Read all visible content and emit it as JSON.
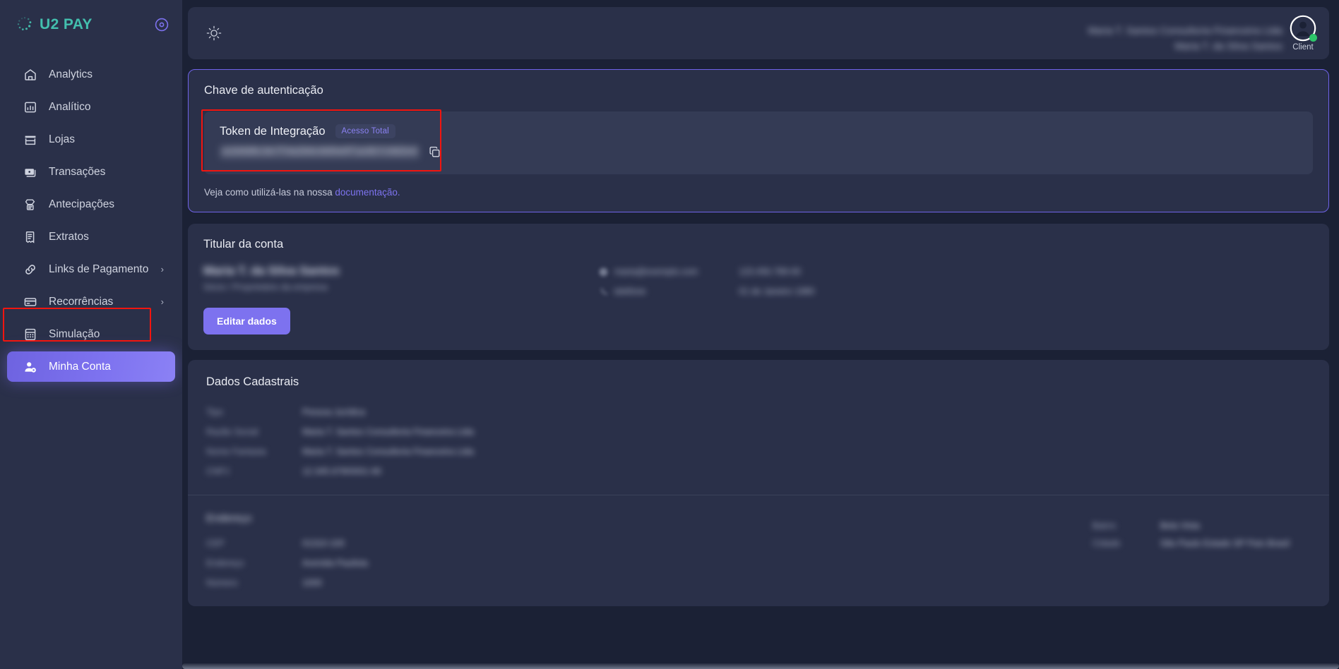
{
  "brand": {
    "name": "U2 PAY",
    "logo_color": "#43bfae",
    "spinner_icon": "dotted-circle-icon",
    "collapse_icon": "circle-dot-icon"
  },
  "accent": {
    "purple": "#7d72ef",
    "teal": "#43bfae",
    "green": "#2ec66a",
    "annotation_red": "#f2150f"
  },
  "sidebar": {
    "items": [
      {
        "label": "Analytics",
        "icon": "home-icon",
        "active": false,
        "has_chevron": false
      },
      {
        "label": "Analítico",
        "icon": "bar-chart-icon",
        "active": false,
        "has_chevron": false
      },
      {
        "label": "Lojas",
        "icon": "store-icon",
        "active": false,
        "has_chevron": false
      },
      {
        "label": "Transações",
        "icon": "money-icon",
        "active": false,
        "has_chevron": false
      },
      {
        "label": "Antecipações",
        "icon": "cash-hand-icon",
        "active": false,
        "has_chevron": false
      },
      {
        "label": "Extratos",
        "icon": "receipt-icon",
        "active": false,
        "has_chevron": false
      },
      {
        "label": "Links de Pagamento",
        "icon": "link-icon",
        "active": false,
        "has_chevron": true,
        "chevron": "›"
      },
      {
        "label": "Recorrências",
        "icon": "credit-card-icon",
        "active": false,
        "has_chevron": true,
        "chevron": "›"
      },
      {
        "label": "Simulação",
        "icon": "calculator-icon",
        "active": false,
        "has_chevron": false
      },
      {
        "label": "Minha Conta",
        "icon": "user-gear-icon",
        "active": true,
        "has_chevron": false
      }
    ]
  },
  "topbar": {
    "theme_toggle_icon": "sun-icon",
    "user_name_blurred": "Maria T. Santos Consultoria Financeira Ltda",
    "user_email_blurred": "Maria T. da Silva Santos",
    "role_label": "Client",
    "avatar_icon": "user-avatar-icon",
    "status_dot_color": "#2ec66a"
  },
  "auth_card": {
    "title": "Chave de autenticação",
    "token_label": "Token de Integração",
    "badge": "Acesso Total",
    "token_value_blurred": "a1b9d8c3e7f4a2b6c0d5e8f1a3b7c9d2e4",
    "copy_icon": "copy-icon",
    "doc_prefix": "Veja como utilizá-las na nossa ",
    "doc_link": "documentação."
  },
  "holder_card": {
    "title": "Titular da conta",
    "name_blurred": "Maria T. da Silva Santos",
    "sub_blurred": "Sócio / Proprietário da empresa",
    "edit_button": "Editar dados",
    "info_columns": [
      {
        "rows": [
          {
            "icon": "at-icon",
            "value_blurred": "maria@exemplo.com"
          },
          {
            "icon": "phone-icon",
            "value_blurred": "telefone"
          }
        ]
      },
      {
        "rows": [
          {
            "icon": "",
            "value_blurred": "123.456.789-00"
          },
          {
            "icon": "",
            "value_blurred": "01 de Janeiro 1980"
          }
        ]
      }
    ]
  },
  "registry_card": {
    "title": "Dados Cadastrais",
    "rows": [
      {
        "key_blurred": "Tipo",
        "value_blurred": "Pessoa Jurídica"
      },
      {
        "key_blurred": "Razão Social",
        "value_blurred": "Maria T. Santos Consultoria Financeira Ltda"
      },
      {
        "key_blurred": "Nome Fantasia",
        "value_blurred": "Maria T. Santos Consultoria Financeira Ltda"
      },
      {
        "key_blurred": "CNPJ",
        "value_blurred": "12.345.678/0001-90"
      }
    ]
  },
  "address_card": {
    "title_blurred": "Endereço",
    "rows": [
      {
        "key_blurred": "CEP",
        "value_blurred": "01310-100"
      },
      {
        "key_blurred": "Endereço",
        "value_blurred": "Avenida Paulista"
      },
      {
        "key_blurred": "Número",
        "value_blurred": "1000"
      }
    ],
    "right_rows": [
      {
        "key_blurred": "Bairro",
        "value_blurred": "Bela Vista"
      },
      {
        "key_blurred": "Cidade",
        "value_blurred": "São Paulo  Estado  SP  País  Brasil"
      }
    ]
  }
}
